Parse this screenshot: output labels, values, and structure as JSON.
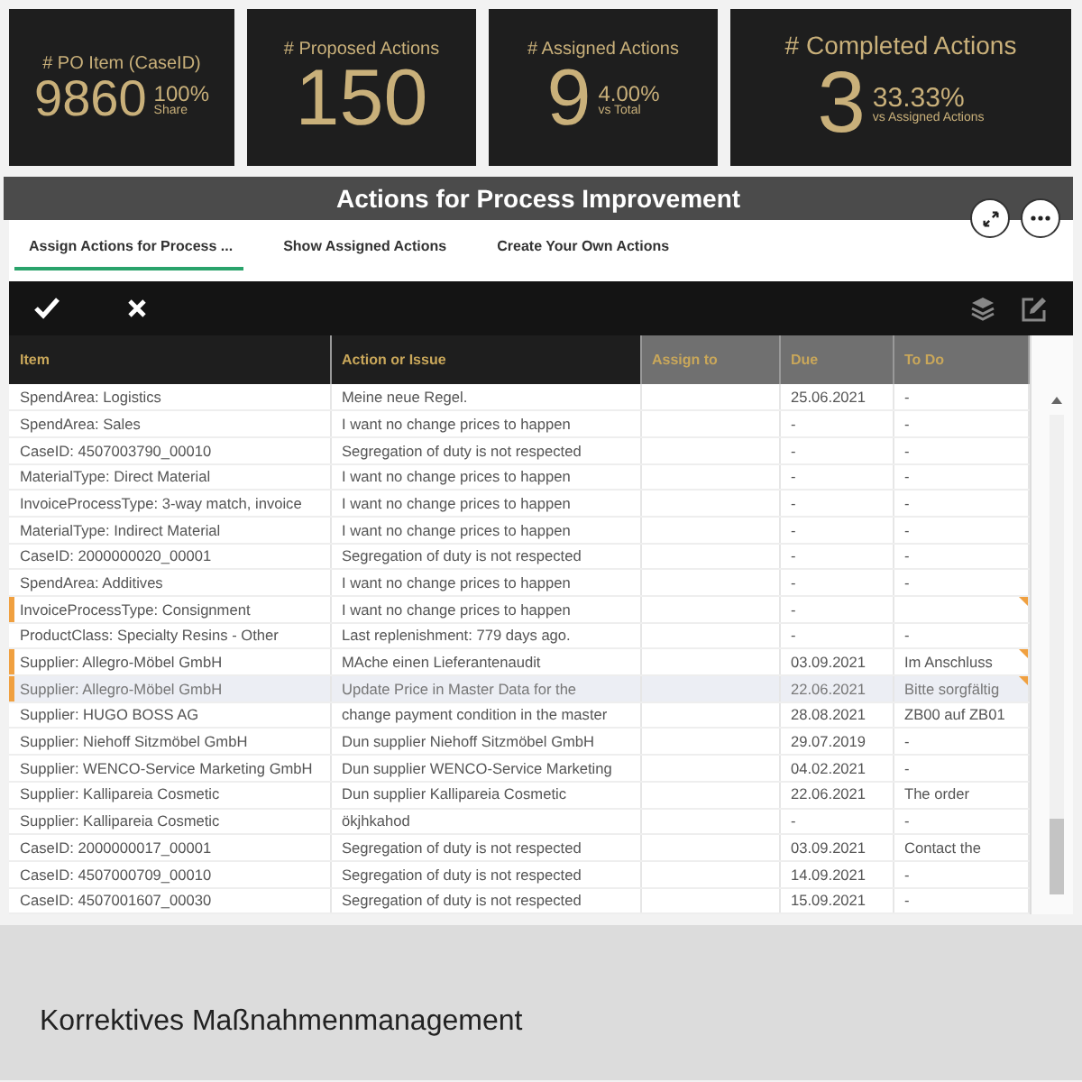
{
  "kpis": [
    {
      "label": "# PO Item (CaseID)",
      "value": "9860",
      "percent": "100%",
      "sublabel": "Share"
    },
    {
      "label": "# Proposed Actions",
      "value": "150"
    },
    {
      "label": "# Assigned Actions",
      "value": "9",
      "percent": "4.00%",
      "sublabel": "vs Total"
    },
    {
      "label": "# Completed Actions",
      "value": "3",
      "percent": "33.33%",
      "sublabel": "vs Assigned Actions"
    }
  ],
  "panel": {
    "title": "Actions for Process Improvement"
  },
  "tabs": [
    {
      "label": "Assign Actions for Process ...",
      "selected": true
    },
    {
      "label": "Show Assigned Actions",
      "selected": false
    },
    {
      "label": "Create Your Own Actions",
      "selected": false
    }
  ],
  "table": {
    "columns": [
      {
        "label": "Item",
        "kind": "primary"
      },
      {
        "label": "Action or Issue",
        "kind": "primary"
      },
      {
        "label": "Assign to",
        "kind": "secondary"
      },
      {
        "label": "Due",
        "kind": "secondary"
      },
      {
        "label": "To Do",
        "kind": "secondary"
      }
    ],
    "rows": [
      {
        "item": "SpendArea: Logistics",
        "action": "Meine neue Regel.",
        "due": "25.06.2021",
        "todo": "-",
        "flagged": false,
        "selected": false,
        "noted": false
      },
      {
        "item": "SpendArea: Sales",
        "action": "I want no change prices to happen",
        "due": "-",
        "todo": "-",
        "flagged": false,
        "selected": false,
        "noted": false
      },
      {
        "item": "CaseID: 4507003790_00010",
        "action": "Segregation of duty is not respected",
        "due": "-",
        "todo": "-",
        "flagged": false,
        "selected": false,
        "noted": false
      },
      {
        "item": "MaterialType: Direct Material",
        "action": "I want no change prices to happen",
        "due": "-",
        "todo": "-",
        "flagged": false,
        "selected": false,
        "noted": false
      },
      {
        "item": "InvoiceProcessType: 3-way match, invoice",
        "action": "I want no change prices to happen",
        "due": "-",
        "todo": "-",
        "flagged": false,
        "selected": false,
        "noted": false
      },
      {
        "item": "MaterialType: Indirect Material",
        "action": "I want no change prices to happen",
        "due": "-",
        "todo": "-",
        "flagged": false,
        "selected": false,
        "noted": false
      },
      {
        "item": "CaseID: 2000000020_00001",
        "action": "Segregation of duty is not respected",
        "due": "-",
        "todo": "-",
        "flagged": false,
        "selected": false,
        "noted": false
      },
      {
        "item": "SpendArea: Additives",
        "action": "I want no change prices to happen",
        "due": "-",
        "todo": "-",
        "flagged": false,
        "selected": false,
        "noted": false
      },
      {
        "item": "InvoiceProcessType: Consignment",
        "action": "I want no change prices to happen",
        "due": "-",
        "flagged": true,
        "selected": false,
        "noted": true
      },
      {
        "item": "ProductClass: Specialty Resins - Other",
        "action": "Last replenishment: 779 days ago.",
        "due": "-",
        "todo": "-",
        "flagged": false,
        "selected": false,
        "noted": false
      },
      {
        "item": "Supplier: Allegro-Möbel GmbH",
        "action": "MAche einen Lieferantenaudit",
        "due": "03.09.2021",
        "todo": "Im Anschluss",
        "flagged": true,
        "selected": false,
        "noted": true
      },
      {
        "item": "Supplier: Allegro-Möbel GmbH",
        "action": "Update Price in Master Data for the",
        "due": "22.06.2021",
        "todo": "Bitte sorgfältig",
        "flagged": true,
        "selected": true,
        "noted": true
      },
      {
        "item": "Supplier: HUGO BOSS AG",
        "action": "change payment condition in the master",
        "due": "28.08.2021",
        "todo": "ZB00 auf ZB01",
        "flagged": false,
        "selected": false,
        "noted": false
      },
      {
        "item": "Supplier: Niehoff Sitzmöbel GmbH",
        "action": "Dun supplier Niehoff Sitzmöbel GmbH",
        "due": "29.07.2019",
        "todo": "-",
        "flagged": false,
        "selected": false,
        "noted": false
      },
      {
        "item": "Supplier: WENCO-Service Marketing GmbH",
        "action": "Dun supplier WENCO-Service Marketing",
        "due": "04.02.2021",
        "todo": "-",
        "flagged": false,
        "selected": false,
        "noted": false
      },
      {
        "item": "Supplier: Kallipareia Cosmetic",
        "action": "Dun supplier Kallipareia Cosmetic",
        "due": "22.06.2021",
        "todo": "The order",
        "flagged": false,
        "selected": false,
        "noted": false
      },
      {
        "item": "Supplier: Kallipareia Cosmetic",
        "action": "ökjhkahod",
        "due": "-",
        "todo": "-",
        "flagged": false,
        "selected": false,
        "noted": false
      },
      {
        "item": "CaseID: 2000000017_00001",
        "action": "Segregation of duty is not respected",
        "due": "03.09.2021",
        "todo": "Contact the",
        "flagged": false,
        "selected": false,
        "noted": false
      },
      {
        "item": "CaseID: 4507000709_00010",
        "action": "Segregation of duty is not respected",
        "due": "14.09.2021",
        "todo": "-",
        "flagged": false,
        "selected": false,
        "noted": false
      },
      {
        "item": "CaseID: 4507001607_00030",
        "action": "Segregation of duty is not respected",
        "due": "15.09.2021",
        "todo": "-",
        "flagged": false,
        "selected": false,
        "noted": false
      }
    ]
  },
  "caption": "Korrektives Maßnahmenmanagement"
}
